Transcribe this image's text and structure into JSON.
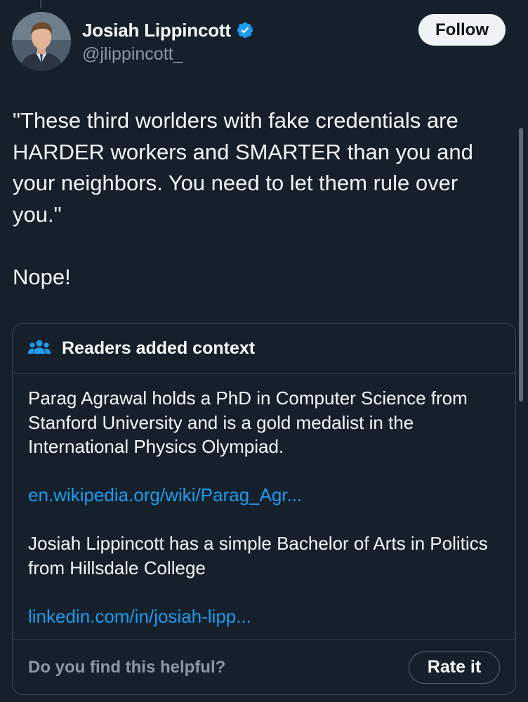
{
  "author": {
    "display_name": "Josiah Lippincott",
    "handle": "@jlippincott_",
    "verified": true,
    "avatar_icon": "profile-photo"
  },
  "follow_button": {
    "label": "Follow"
  },
  "tweet": {
    "lines": [
      "\"These third worlders with fake credentials are HARDER workers and SMARTER than you and your neighbors. You need to let them rule over you.\"",
      "Nope!"
    ]
  },
  "community_note": {
    "icon": "people-icon",
    "title": "Readers added context",
    "paragraphs": [
      "Parag Agrawal holds a PhD in Computer Science from Stanford University and is a gold medalist in the International Physics Olympiad.",
      "Josiah Lippincott has a simple Bachelor of Arts in Politics from Hillsdale College"
    ],
    "links": [
      "en.wikipedia.org/wiki/Parag_Agr...",
      "linkedin.com/in/josiah-lipp..."
    ],
    "helpful_question": "Do you find this helpful?",
    "rate_button_label": "Rate it"
  },
  "colors": {
    "background": "#15202b",
    "text": "#f7f9f9",
    "secondary_text": "#8b98a5",
    "link": "#1d9bf0",
    "verified_badge": "#1d9bf0",
    "border": "#38444d"
  }
}
